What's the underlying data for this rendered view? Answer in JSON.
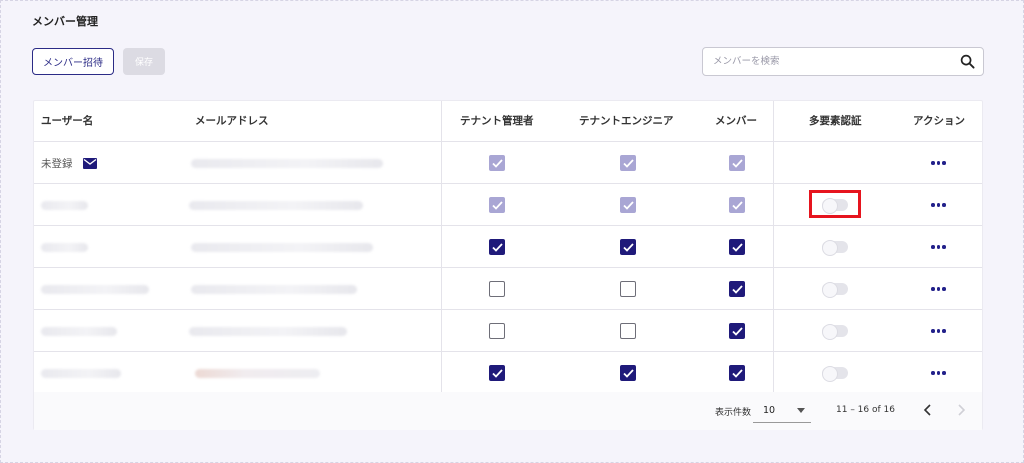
{
  "page": {
    "title": "メンバー管理"
  },
  "toolbar": {
    "invite_label": "メンバー招待",
    "save_label": "保存"
  },
  "search": {
    "placeholder": "メンバーを検索",
    "value": ""
  },
  "table": {
    "headers": {
      "username": "ユーザー名",
      "email": "メールアドレス",
      "tenant_admin": "テナント管理者",
      "tenant_engineer": "テナントエンジニア",
      "member": "メンバー",
      "mfa": "多要素認証",
      "action": "アクション"
    },
    "rows": [
      {
        "status_text": "未登録",
        "tenant_admin": "disabled",
        "tenant_engineer": "disabled",
        "member": "disabled",
        "mfa": "none"
      },
      {
        "tenant_admin": "disabled",
        "tenant_engineer": "disabled",
        "member": "disabled",
        "mfa": "off"
      },
      {
        "tenant_admin": "checked",
        "tenant_engineer": "checked",
        "member": "checked",
        "mfa": "off"
      },
      {
        "tenant_admin": "unchecked",
        "tenant_engineer": "unchecked",
        "member": "checked",
        "mfa": "off"
      },
      {
        "tenant_admin": "unchecked",
        "tenant_engineer": "unchecked",
        "member": "checked",
        "mfa": "off"
      },
      {
        "tenant_admin": "checked",
        "tenant_engineer": "checked",
        "member": "checked",
        "mfa": "off"
      }
    ]
  },
  "pagination": {
    "per_page_label": "表示件数",
    "per_page_value": "10",
    "range_text": "11 – 16 of 16"
  },
  "colors": {
    "accent": "#1f1a7a",
    "highlight": "#e6141e"
  }
}
